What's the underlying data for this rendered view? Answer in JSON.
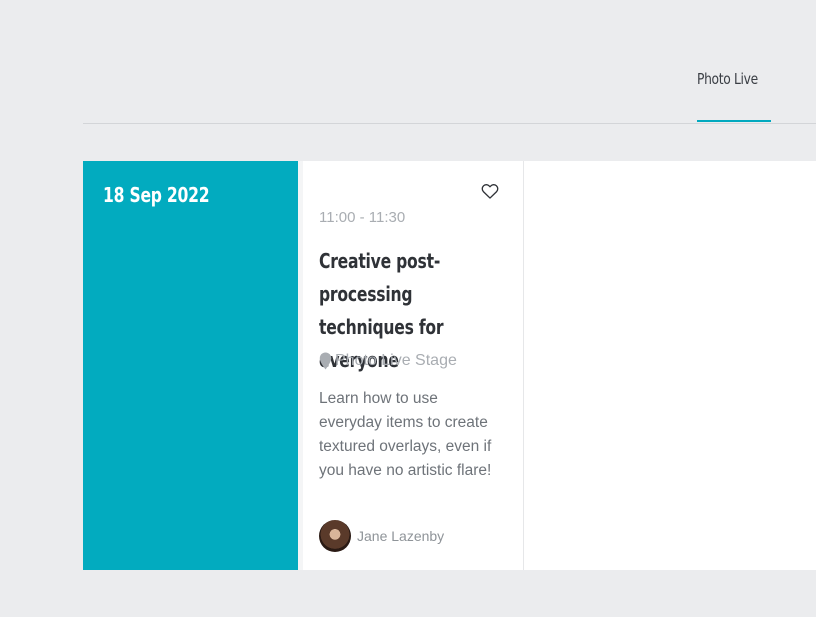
{
  "tabs": [
    {
      "label": "Photo Live",
      "active": true
    }
  ],
  "day": {
    "date": "18 Sep 2022"
  },
  "session": {
    "time": "11:00 - 11:30",
    "title": "Creative post-processing techniques for everyone",
    "location": "Photo Live Stage",
    "description": "Learn how to use everyday items to create textured overlays, even if you have no artistic flare!",
    "speaker": "Jane Lazenby",
    "favorite_icon": "heart-outline-icon",
    "location_icon": "map-pin-icon"
  },
  "colors": {
    "accent": "#02abbf",
    "background": "#ebecee",
    "card": "#ffffff"
  }
}
